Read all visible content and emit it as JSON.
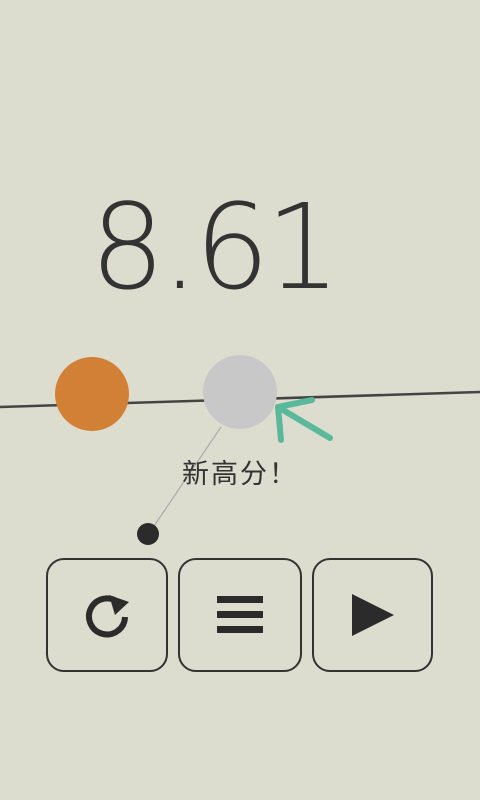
{
  "game": {
    "score": "8.61",
    "message": "新高分！"
  },
  "colors": {
    "background": "#dcdccf",
    "orange_ball": "#d18035",
    "gray_ball": "#c8c8c8",
    "arrow": "#5ab99b",
    "ink": "#333333"
  },
  "buttons": [
    {
      "icon": "restart-icon"
    },
    {
      "icon": "menu-icon"
    },
    {
      "icon": "play-icon"
    }
  ]
}
